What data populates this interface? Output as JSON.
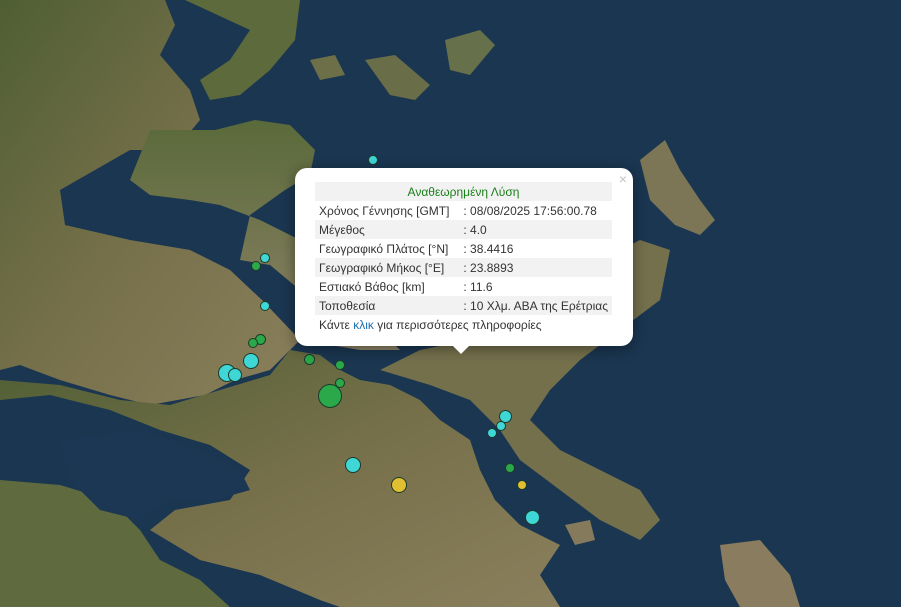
{
  "popup": {
    "title": "Αναθεωρημένη Λύση",
    "rows": [
      {
        "label": "Χρόνος Γέννησης [GMT]",
        "value": ": 08/08/2025 17:56:00.78"
      },
      {
        "label": "Μέγεθος",
        "value": ": 4.0"
      },
      {
        "label": "Γεωγραφικό Πλάτος [°N]",
        "value": ": 38.4416"
      },
      {
        "label": "Γεωγραφικό Μήκος [°E]",
        "value": ": 23.8893"
      },
      {
        "label": "Εστιακό Βάθος [km]",
        "value": ": 11.6"
      },
      {
        "label": "Τοποθεσία",
        "value": ": 10 Χλμ. ΑΒΑ της Ερέτριας"
      }
    ],
    "more_prefix": "Κάντε ",
    "more_link": "κλικ",
    "more_suffix": " για περισσότερες πληροφορίες",
    "close_icon": "×"
  },
  "colors": {
    "cyan": "#3fd6d6",
    "green": "#2aa84a",
    "yellow": "#e0c030",
    "sea": "#1a3550",
    "land": "#6b6a45"
  }
}
